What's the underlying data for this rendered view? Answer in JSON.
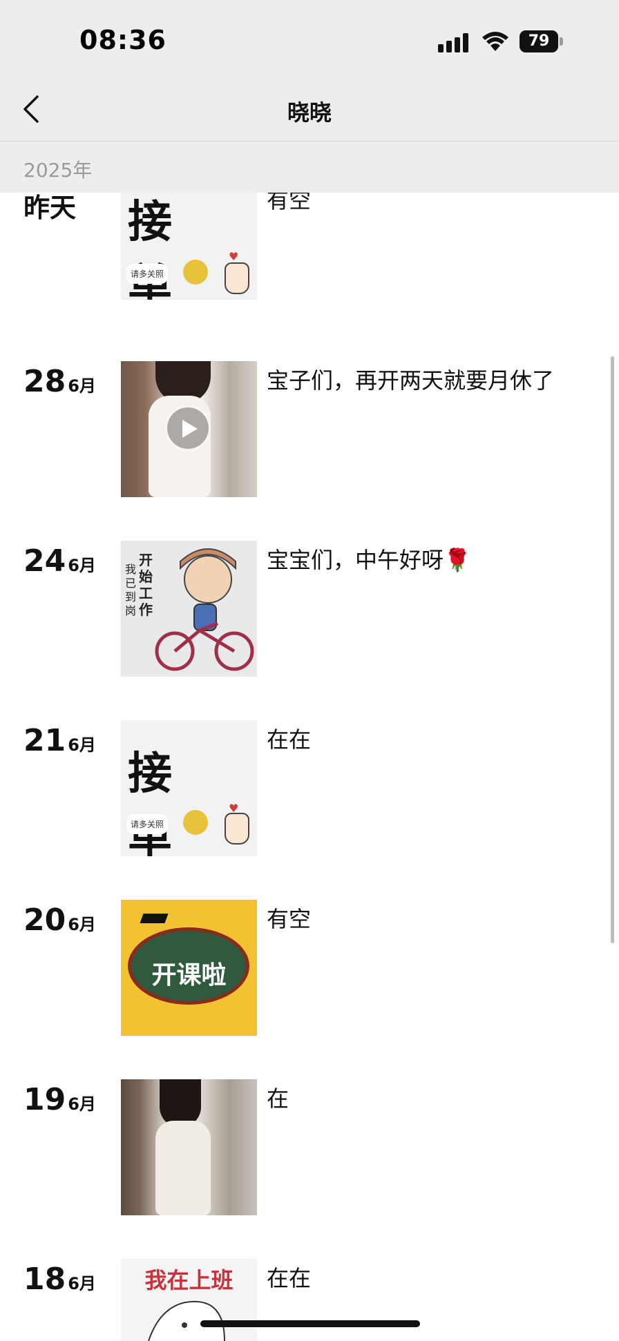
{
  "status_bar": {
    "time": "08:36",
    "battery": "79",
    "icons": [
      "signal-icon",
      "wifi-icon",
      "battery-icon"
    ]
  },
  "nav": {
    "title": "晓晓",
    "back_icon": "chevron-left-icon"
  },
  "year_header": "2025年",
  "posts": [
    {
      "date_text": "昨天",
      "caption": "有空",
      "thumb": "接单 image",
      "month": ""
    },
    {
      "day": "28",
      "month": "6月",
      "caption": "宝子们，再开两天就要月休了",
      "thumb": "video"
    },
    {
      "day": "24",
      "month": "6月",
      "caption": "宝宝们，中午好呀🌹",
      "thumb": "cartoon"
    },
    {
      "day": "21",
      "month": "6月",
      "caption": "在在",
      "thumb": "接单 image"
    },
    {
      "day": "20",
      "month": "6月",
      "caption": "有空",
      "thumb": "开课啦 image"
    },
    {
      "day": "19",
      "month": "6月",
      "caption": "在",
      "thumb": "photo"
    },
    {
      "day": "18",
      "month": "6月",
      "caption": "在在",
      "thumb": "我在上班 image"
    }
  ],
  "thumb_text": {
    "jiedan_big": "接 单",
    "jiedan_small": "请多关照",
    "bike_vertical": "开始工作",
    "bike_vertical2": "我已到岗",
    "class_label": "开课啦",
    "work_label": "我在上班"
  }
}
